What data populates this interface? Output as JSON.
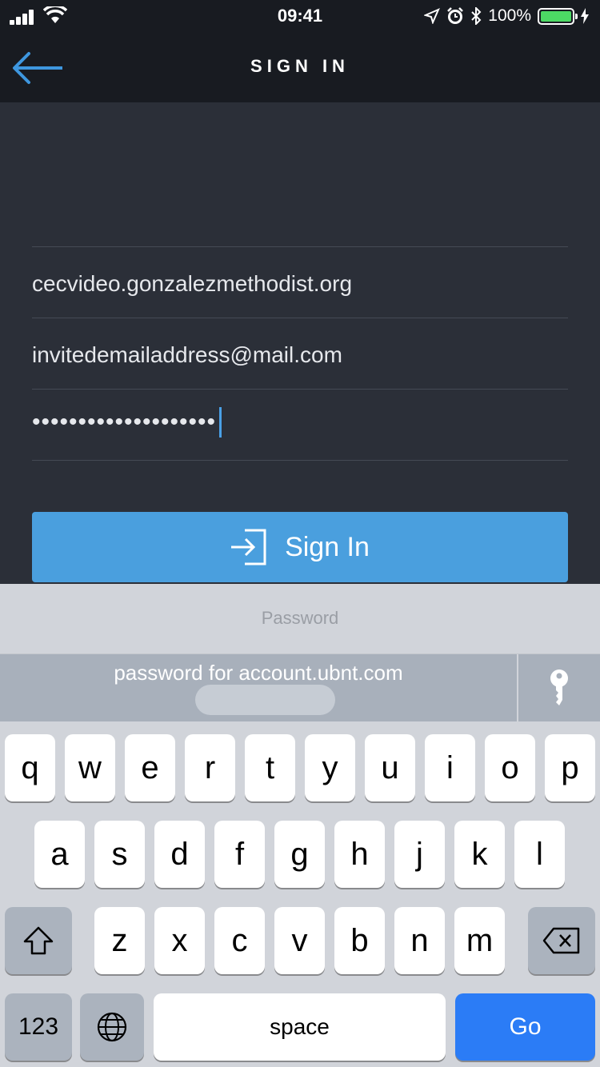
{
  "status_bar": {
    "time": "09:41",
    "battery": "100%"
  },
  "nav": {
    "title": "SIGN IN"
  },
  "form": {
    "server": "cecvideo.gonzalezmethodist.org",
    "email": "invitedemailaddress@mail.com",
    "password": "••••••••••••••••••••",
    "submit_label": "Sign In"
  },
  "keyboard": {
    "field_label": "Password",
    "suggestion": "password for account.ubnt.com",
    "row1": [
      "q",
      "w",
      "e",
      "r",
      "t",
      "y",
      "u",
      "i",
      "o",
      "p"
    ],
    "row2": [
      "a",
      "s",
      "d",
      "f",
      "g",
      "h",
      "j",
      "k",
      "l"
    ],
    "row3": [
      "z",
      "x",
      "c",
      "v",
      "b",
      "n",
      "m"
    ],
    "num_label": "123",
    "space_label": "space",
    "go_label": "Go"
  },
  "colors": {
    "accent": "#4a9fde",
    "go": "#2b7cf6",
    "battery": "#4cd964"
  }
}
